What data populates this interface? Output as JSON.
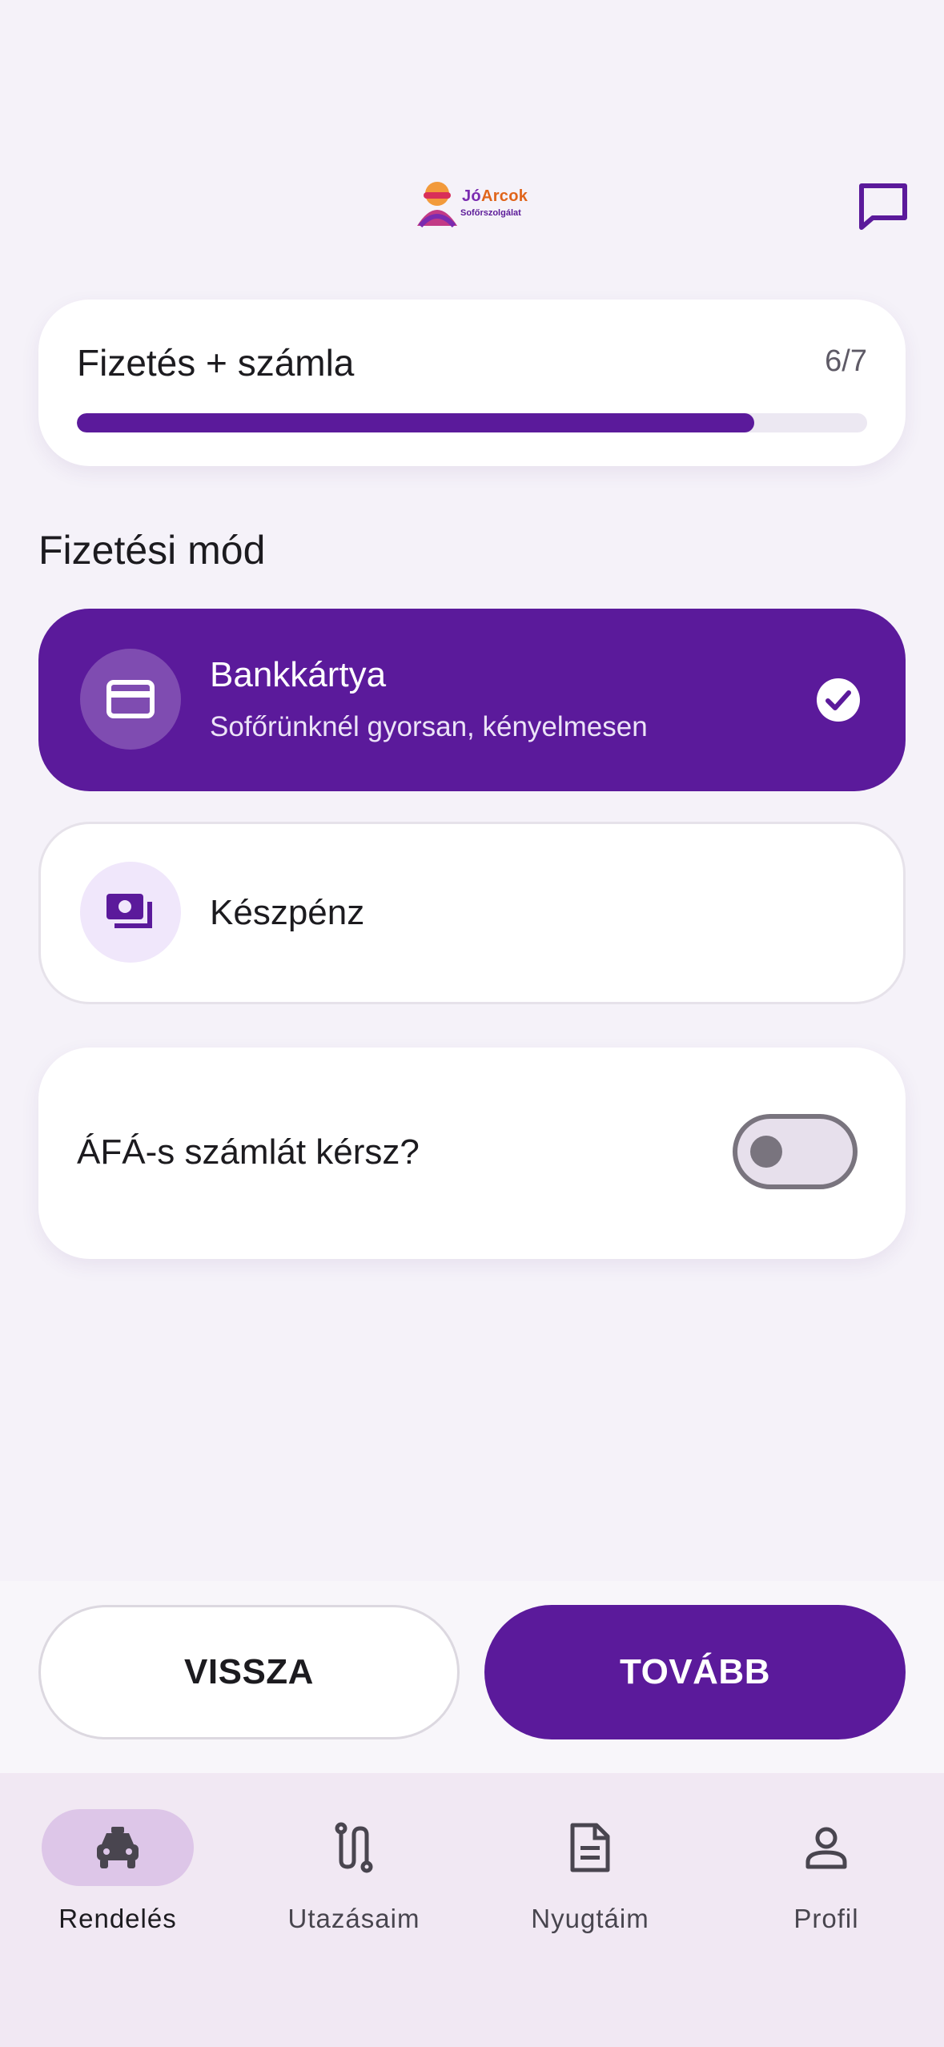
{
  "header": {
    "logo_primary_a": "Jó",
    "logo_primary_b": "Arcok",
    "logo_secondary": "Sofőrszolgálat",
    "chat_icon": "chat-bubble-icon"
  },
  "progress": {
    "title": "Fizetés + számla",
    "count": "6/7",
    "fraction": 0.857
  },
  "payment": {
    "section_title": "Fizetési mód",
    "options": [
      {
        "title": "Bankkártya",
        "subtitle": "Sofőrünknél gyorsan, kényelmesen",
        "icon": "credit-card-icon",
        "selected": true
      },
      {
        "title": "Készpénz",
        "icon": "cash-icon",
        "selected": false
      }
    ]
  },
  "vat": {
    "label": "ÁFÁ-s számlát kérsz?",
    "enabled": false
  },
  "actions": {
    "back_label": "VISSZA",
    "next_label": "TOVÁBB"
  },
  "nav": {
    "items": [
      {
        "label": "Rendelés",
        "icon": "taxi-icon",
        "active": true
      },
      {
        "label": "Utazásaim",
        "icon": "route-icon",
        "active": false
      },
      {
        "label": "Nyugtáim",
        "icon": "receipt-icon",
        "active": false
      },
      {
        "label": "Profil",
        "icon": "person-icon",
        "active": false
      }
    ]
  },
  "colors": {
    "primary": "#5b1a9b",
    "background": "#f5f2f9",
    "nav_background": "#f1e8f3",
    "active_pill": "#ddc6e8"
  }
}
